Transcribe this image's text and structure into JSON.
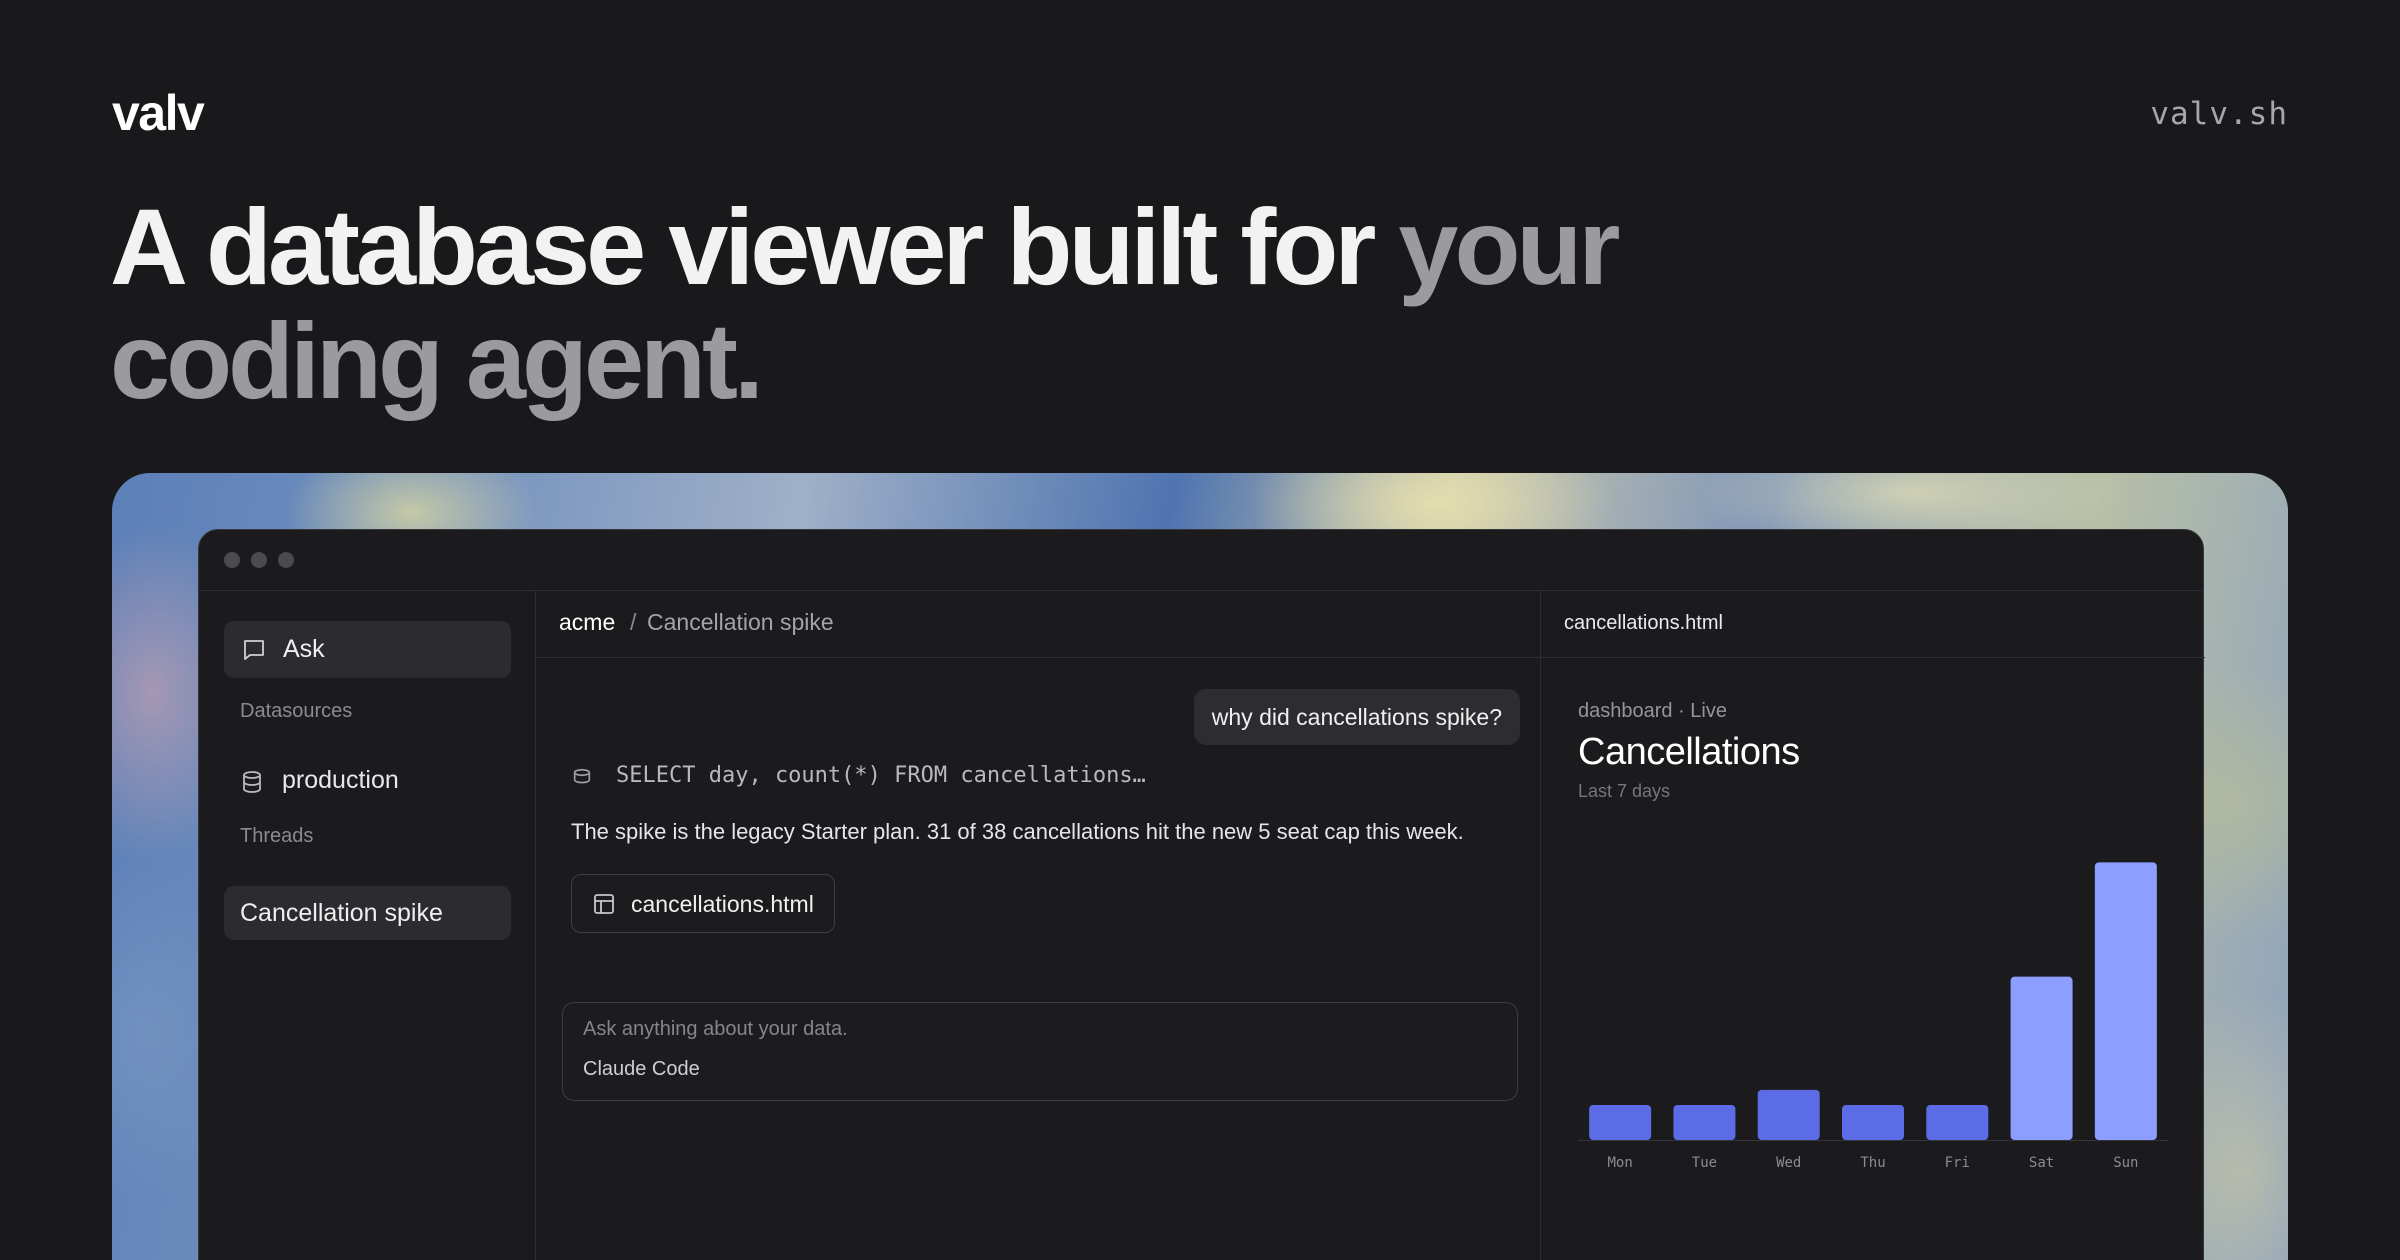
{
  "brand": "valv",
  "site": "valv.sh",
  "headline": {
    "primary": "A database viewer built for",
    "muted": "your coding agent."
  },
  "app": {
    "sidebar": {
      "ask_label": "Ask",
      "datasources_heading": "Datasources",
      "datasource": "production",
      "threads_heading": "Threads",
      "thread": "Cancellation spike"
    },
    "main": {
      "breadcrumb": {
        "workspace": "acme",
        "separator": "/",
        "thread": "Cancellation spike"
      },
      "user_message": "why did cancellations spike?",
      "sql": "SELECT day, count(*) FROM cancellations…",
      "answer": "The spike is the legacy Starter plan. 31 of 38 cancellations hit the new 5 seat cap this week.",
      "file_chip": "cancellations.html",
      "composer": {
        "placeholder": "Ask anything about your data.",
        "agent": "Claude Code"
      }
    },
    "panel": {
      "tab": "cancellations.html",
      "meta": "dashboard · Live",
      "title": "Cancellations",
      "subtitle": "Last 7 days"
    }
  },
  "colors": {
    "bar_normal": "#5c6be6",
    "bar_highlight": "#8c9eff",
    "background": "#19191b"
  },
  "chart_data": {
    "type": "bar",
    "categories": [
      "Mon",
      "Tue",
      "Wed",
      "Thu",
      "Fri",
      "Sat",
      "Sun"
    ],
    "values": [
      3,
      3,
      4.3,
      3,
      3,
      14,
      23.8
    ],
    "highlighted": [
      "Sat",
      "Sun"
    ],
    "title": "Cancellations",
    "subtitle": "Last 7 days",
    "ylim": [
      0,
      24
    ],
    "grid": false
  }
}
